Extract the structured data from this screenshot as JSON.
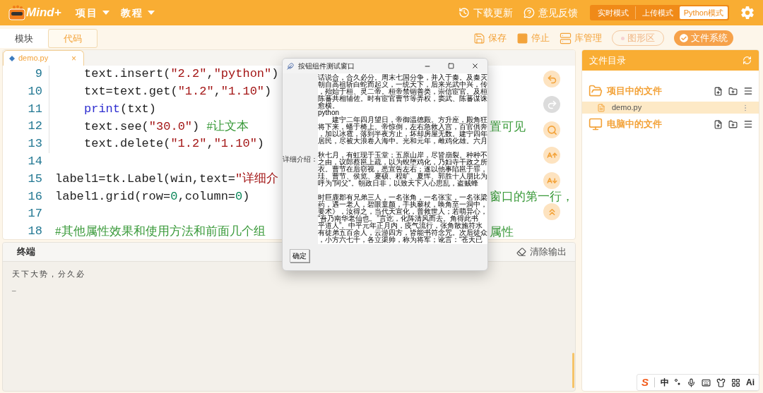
{
  "header": {
    "logo": "Mind+",
    "menus": [
      {
        "label": "项目"
      },
      {
        "label": "教程"
      }
    ],
    "links": [
      {
        "kind": "update",
        "label": "下载更新"
      },
      {
        "kind": "feedback",
        "label": "意见反馈"
      }
    ],
    "modes": [
      {
        "label": "实时模式",
        "selected": false
      },
      {
        "label": "上传模式",
        "selected": false
      },
      {
        "label": "Python模式",
        "selected": true
      }
    ]
  },
  "view_tabs": [
    {
      "label": "模块",
      "selected": false
    },
    {
      "label": "代码",
      "selected": true
    }
  ],
  "toolbar": [
    {
      "kind": "save",
      "label": "保存"
    },
    {
      "kind": "stop",
      "label": "停止"
    },
    {
      "kind": "library",
      "label": "库管理"
    },
    {
      "kind": "toggle",
      "label": "图形区",
      "on": false
    },
    {
      "kind": "toggle",
      "label": "文件系统",
      "on": true
    }
  ],
  "editor": {
    "file_tab": {
      "label": "demo.py",
      "close": "×"
    },
    "lines": [
      {
        "number": "9",
        "indent": true,
        "left": [
          {
            "kind": "plain",
            "text": "text.insert("
          },
          {
            "kind": "string",
            "text": "\"2.2\""
          },
          {
            "kind": "plain",
            "text": ","
          },
          {
            "kind": "string",
            "text": "\"python\""
          },
          {
            "kind": "plain",
            "text": ")"
          }
        ]
      },
      {
        "number": "10",
        "indent": true,
        "left": [
          {
            "kind": "plain",
            "text": "txt=text.get("
          },
          {
            "kind": "string",
            "text": "\"1.2\""
          },
          {
            "kind": "plain",
            "text": ","
          },
          {
            "kind": "string",
            "text": "\"1.10\""
          },
          {
            "kind": "plain",
            "text": ")"
          }
        ]
      },
      {
        "number": "11",
        "indent": true,
        "left": [
          {
            "kind": "builtin",
            "text": "print"
          },
          {
            "kind": "plain",
            "text": "(txt)"
          }
        ]
      },
      {
        "number": "12",
        "indent": true,
        "left": [
          {
            "kind": "plain",
            "text": "text.see("
          },
          {
            "kind": "string",
            "text": "\"30.0\""
          },
          {
            "kind": "plain",
            "text": ")     "
          },
          {
            "kind": "comment",
            "text": "#让文本"
          }
        ],
        "right": [
          {
            "kind": "comment",
            "text": "置可见"
          }
        ]
      },
      {
        "number": "13",
        "indent": true,
        "left": [
          {
            "kind": "plain",
            "text": "text.delete("
          },
          {
            "kind": "string",
            "text": "\"1.2\""
          },
          {
            "kind": "plain",
            "text": ","
          },
          {
            "kind": "string",
            "text": "\"1.10\""
          },
          {
            "kind": "plain",
            "text": ")"
          }
        ]
      },
      {
        "number": "14",
        "indent": false
      },
      {
        "number": "15",
        "indent": false,
        "left": [
          {
            "kind": "plain",
            "text": "label1=tk.Label(win,text="
          },
          {
            "kind": "string",
            "text": "\"详细介"
          }
        ]
      },
      {
        "number": "16",
        "indent": false,
        "left": [
          {
            "kind": "plain",
            "text": "label1.grid(row="
          },
          {
            "kind": "number",
            "text": "0"
          },
          {
            "kind": "plain",
            "text": ",column="
          },
          {
            "kind": "number",
            "text": "0"
          },
          {
            "kind": "plain",
            "text": ")"
          }
        ],
        "right": [
          {
            "kind": "comment",
            "text": "窗口的第一行，"
          }
        ]
      },
      {
        "number": "17",
        "indent": false
      },
      {
        "number": "18",
        "indent": false,
        "left": [
          {
            "kind": "comment",
            "text": "#其他属性效果和使用方法和前面几个组"
          }
        ],
        "right": [
          {
            "kind": "comment",
            "text": "属性"
          }
        ]
      }
    ],
    "tools": [
      {
        "kind": "undo",
        "disabled": false
      },
      {
        "kind": "redo",
        "disabled": true
      },
      {
        "kind": "search",
        "disabled": false
      },
      {
        "kind": "zoom_in",
        "disabled": false
      },
      {
        "kind": "zoom_out",
        "disabled": false
      },
      {
        "kind": "top",
        "disabled": false
      }
    ]
  },
  "dialog": {
    "title": "按钮组件测试窗口",
    "label": "详细介绍：",
    "button": "确定",
    "paragraphs": [
      [
        "话说合，合久必分。周末七国分争，并入于秦。及秦灭",
        "朝自高祖斩白蛇而起义，一统天下，后来光武中兴，传",
        "，殆始于桓、灵二帝。桓帝禁锢善类，崇信宦官。及桓",
        "陈蕃共相辅佐。时有宦官曹节等弄权，窦武、陈蕃谋诛",
        "愈横。",
        "python",
        "　　建宁二年四月望日，帝御温德殿。方升座，殿角狂",
        "将下来，蟠于椅上。帝惊倒，左右急救入宫，百官俱奔",
        "，加以冰雹，落到半夜方止，坏却房屋无数。建宁四年",
        "居民，尽被大浪卷入海中。光和元年，雌鸡化雄。六月"
      ],
      [
        "秋七月，有虹现于玉堂；五原山岸，尽皆崩裂。种种不",
        "之由，议郎蔡邕上疏，以为蜺堕鸡化，乃妇寺干政之所",
        "衣。曹节在后窃视，悉宣告左右；遂以他事陷邕于罪，",
        "珪、曹节、侯览、蹇硕、程旷、夏恽、郭胜十人朋比为",
        "呼为“阿父”。朝政日非，以致天下人心思乱，盗贼蜂"
      ],
      [
        "时巨鹿郡有兄弟三人，一名张角，一名张宝，一名张梁",
        "药，遇一老人，碧眼童颜，手执藜杖，唤角至一洞中，",
        "要术》，汝得之，当代天宣化，普救世人；若萌异心，",
        "“吾乃南华老仙也。”言讫，化阵清风而去。角得此书",
        "平道人”。中平元年正月内，疫气流行，张角散施符水",
        "有徒弟五百余人，云游四方，皆能书符念咒。次后徒众",
        "，小方六七千，各立渠帅，称为将军；讹言：“苍天已"
      ]
    ]
  },
  "terminal": {
    "title": "终端",
    "clear": "清除输出",
    "output": "天下大势，分久必",
    "cursor": "_"
  },
  "files": {
    "title": "文件目录",
    "sections": [
      {
        "kind": "project",
        "label": "项目中的文件",
        "files": [
          {
            "label": "demo.py",
            "selected": true
          }
        ]
      },
      {
        "kind": "computer",
        "label": "电脑中的文件"
      }
    ]
  },
  "ime": {
    "logo": "S",
    "items": [
      {
        "kind": "text",
        "label": "中"
      },
      {
        "kind": "punct"
      },
      {
        "kind": "mic"
      },
      {
        "kind": "keyboard"
      },
      {
        "kind": "skin"
      },
      {
        "kind": "apps"
      },
      {
        "kind": "text",
        "label": "Ai"
      }
    ]
  }
}
